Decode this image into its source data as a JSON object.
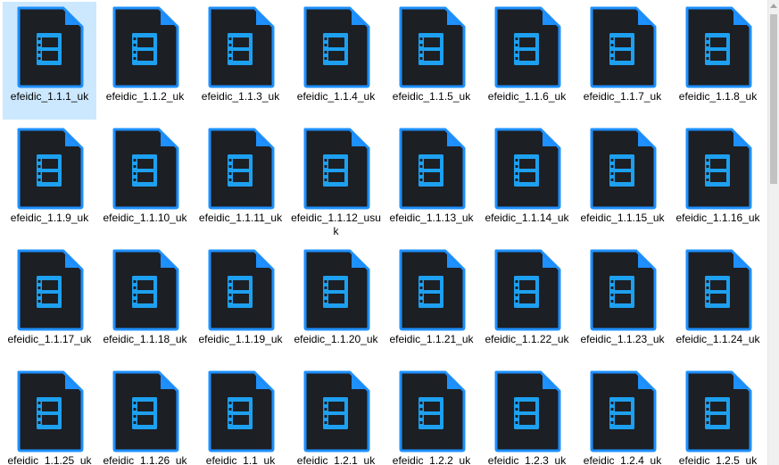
{
  "icon": {
    "name": "video-file-icon",
    "body_color": "#1c1f24",
    "outline_color": "#1e90ff",
    "glyph_color": "#1ea0f0"
  },
  "selected_index": 0,
  "files": [
    {
      "name": "efeidic_1.1.1_uk"
    },
    {
      "name": "efeidic_1.1.2_uk"
    },
    {
      "name": "efeidic_1.1.3_uk"
    },
    {
      "name": "efeidic_1.1.4_uk"
    },
    {
      "name": "efeidic_1.1.5_uk"
    },
    {
      "name": "efeidic_1.1.6_uk"
    },
    {
      "name": "efeidic_1.1.7_uk"
    },
    {
      "name": "efeidic_1.1.8_uk"
    },
    {
      "name": "efeidic_1.1.9_uk"
    },
    {
      "name": "efeidic_1.1.10_uk"
    },
    {
      "name": "efeidic_1.1.11_uk"
    },
    {
      "name": "efeidic_1.1.12_usuk"
    },
    {
      "name": "efeidic_1.1.13_uk"
    },
    {
      "name": "efeidic_1.1.14_uk"
    },
    {
      "name": "efeidic_1.1.15_uk"
    },
    {
      "name": "efeidic_1.1.16_uk"
    },
    {
      "name": "efeidic_1.1.17_uk"
    },
    {
      "name": "efeidic_1.1.18_uk"
    },
    {
      "name": "efeidic_1.1.19_uk"
    },
    {
      "name": "efeidic_1.1.20_uk"
    },
    {
      "name": "efeidic_1.1.21_uk"
    },
    {
      "name": "efeidic_1.1.22_uk"
    },
    {
      "name": "efeidic_1.1.23_uk"
    },
    {
      "name": "efeidic_1.1.24_uk"
    },
    {
      "name": "efeidic_1.1.25_uk"
    },
    {
      "name": "efeidic_1.1.26_uk"
    },
    {
      "name": "efeidic_1.1_uk"
    },
    {
      "name": "efeidic_1.2.1_uk"
    },
    {
      "name": "efeidic_1.2.2_uk"
    },
    {
      "name": "efeidic_1.2.3_uk"
    },
    {
      "name": "efeidic_1.2.4_uk"
    },
    {
      "name": "efeidic_1.2.5_uk"
    }
  ]
}
